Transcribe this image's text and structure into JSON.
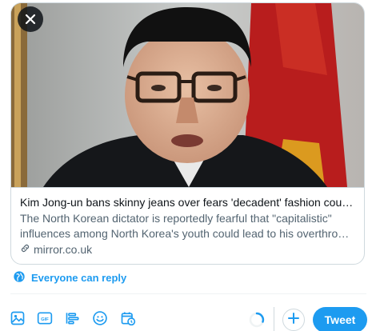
{
  "link_card": {
    "title": "Kim Jong-un bans skinny jeans over fears 'decadent' fashion could top...",
    "description": "The North Korean dictator is reportedly fearful that \"capitalistic\" influences among North Korea's youth could lead to his overthrow - ...",
    "domain": "mirror.co.uk",
    "close_icon": "close-icon",
    "link_icon": "link-icon"
  },
  "reply_setting": {
    "label": "Everyone can reply",
    "icon": "globe-icon"
  },
  "toolbar": {
    "icons": [
      "media-icon",
      "gif-icon",
      "poll-icon",
      "emoji-icon",
      "schedule-icon"
    ],
    "add_icon": "plus-icon",
    "tweet_label": "Tweet"
  },
  "colors": {
    "accent": "#1d9bf0",
    "text": "#0f1419",
    "secondary_text": "#536471",
    "border": "#cfd9de"
  }
}
